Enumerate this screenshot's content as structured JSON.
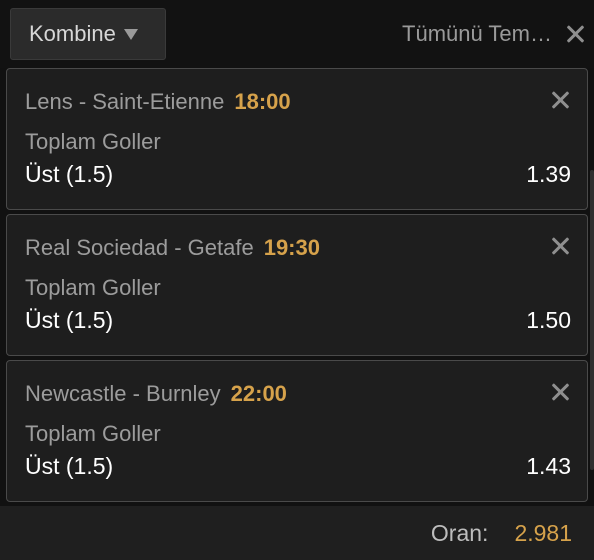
{
  "header": {
    "bet_type": "Kombine",
    "clear_all": "Tümünü Tem…"
  },
  "bets": [
    {
      "match": "Lens - Saint-Etienne",
      "time": "18:00",
      "market": "Toplam Goller",
      "selection": "Üst (1.5)",
      "odd": "1.39"
    },
    {
      "match": "Real Sociedad - Getafe",
      "time": "19:30",
      "market": "Toplam Goller",
      "selection": "Üst (1.5)",
      "odd": "1.50"
    },
    {
      "match": "Newcastle - Burnley",
      "time": "22:00",
      "market": "Toplam Goller",
      "selection": "Üst (1.5)",
      "odd": "1.43"
    }
  ],
  "footer": {
    "odds_label": "Oran:",
    "odds_value": "2.981"
  },
  "colors": {
    "accent": "#d6a24b",
    "background": "#111111",
    "card": "#1e1e1e"
  }
}
